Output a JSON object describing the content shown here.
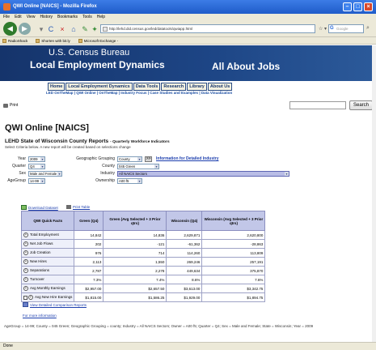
{
  "browser": {
    "title": "QWI Online [NAICS] - Mozilla Firefox",
    "menu": [
      "File",
      "Edit",
      "View",
      "History",
      "Bookmarks",
      "Tools",
      "Help"
    ],
    "url": "http://lehd.did.census.gov/led/datatools/qwiapp.html",
    "search_placeholder": "Google",
    "bookmarks": [
      "RadioShack",
      "Shorten with bit.ly",
      "Microsoft Exchange -"
    ],
    "status": "Done"
  },
  "site": {
    "bureau": "U.S. Census Bureau",
    "program": "Local Employment Dynamics",
    "tagline": "All About Jobs",
    "tabs": [
      "Home",
      "Local Employment Dynamics",
      "Data Tools",
      "Research",
      "Library",
      "About Us"
    ],
    "subnav": "LED OnTheMap | QWI Online | OnTheMap | Industry Focus | Case Studies and Examples | Data Visualization",
    "print_label": "Print",
    "search_button": "Search"
  },
  "page": {
    "title": "QWI Online [NAICS]",
    "report_heading": "LEHD State of Wisconsin County Reports",
    "report_sub": "- Quarterly Workforce Indicators",
    "instructions": "Select Criteria below. A new report will be created based on selections change"
  },
  "form": {
    "year_label": "Year",
    "year_value": "2009",
    "quarter_label": "Quarter",
    "quarter_value": "Q4",
    "sex_label": "Sex",
    "sex_value": "Male and Female",
    "agegroup_label": "AgeGroup",
    "agegroup_value": "14-99",
    "geo_label": "Geographic Grouping",
    "geo_value": "County",
    "county_label": "County",
    "county_value": "045 Green",
    "industry_label": "Industry",
    "industry_value": "All NAICS Sectors",
    "ownership_label": "Ownership",
    "ownership_value": "A00 f5",
    "go_label": ">>",
    "info_link": "Information for Detailed Industry"
  },
  "links": {
    "download": "Download Dataset",
    "print_table": "Print Table",
    "compare": "View Detailed Comparison Reports",
    "more_info": "For more information"
  },
  "table": {
    "headers": [
      "QWI Quick Facts",
      "Green (Q4)",
      "Green (Avg Selected + 3 Prior qtrs)",
      "Wisconsin (Q4)",
      "Wisconsin (Avg Selected + 3 Prior qtrs)"
    ],
    "rows": [
      {
        "label": "Total Employment",
        "v1": "14,842",
        "v2": "14,836",
        "v3": "2,629,871",
        "v4": "2,620,800"
      },
      {
        "label": "Net Job Flows",
        "v1": "202",
        "v2": "-121",
        "v3": "-61,362",
        "v4": "-28,863"
      },
      {
        "label": "Job Creation",
        "v1": "976",
        "v2": "714",
        "v3": "114,260",
        "v4": "113,809"
      },
      {
        "label": "New Hires",
        "v1": "2,113",
        "v2": "1,550",
        "v3": "269,246",
        "v4": "257,191"
      },
      {
        "label": "Separations",
        "v1": "2,787",
        "v2": "2,278",
        "v3": "449,634",
        "v4": "375,870"
      },
      {
        "label": "Turnover",
        "v1": "7.3%",
        "v2": "7.4%",
        "v3": "8.6%",
        "v4": "7.6%"
      },
      {
        "label": "Avg Monthly Earnings",
        "v1": "$2,957.00",
        "v2": "$2,657.50",
        "v3": "$3,613.00",
        "v4": "$3,342.75"
      },
      {
        "label": "Avg New Hire Earnings",
        "v1": "$1,815.00",
        "v2": "$1,586.25",
        "v3": "$1,929.00",
        "v4": "$1,894.75"
      }
    ]
  },
  "footnote": "AgeGroup = 14-99; County = 045 Green; Geographic Grouping = county; Industry = All NAICS Sectors; Owner = A00 f5; Quarter = Q4; Sex = Male and Female; State = Wisconsin; Year = 2009"
}
